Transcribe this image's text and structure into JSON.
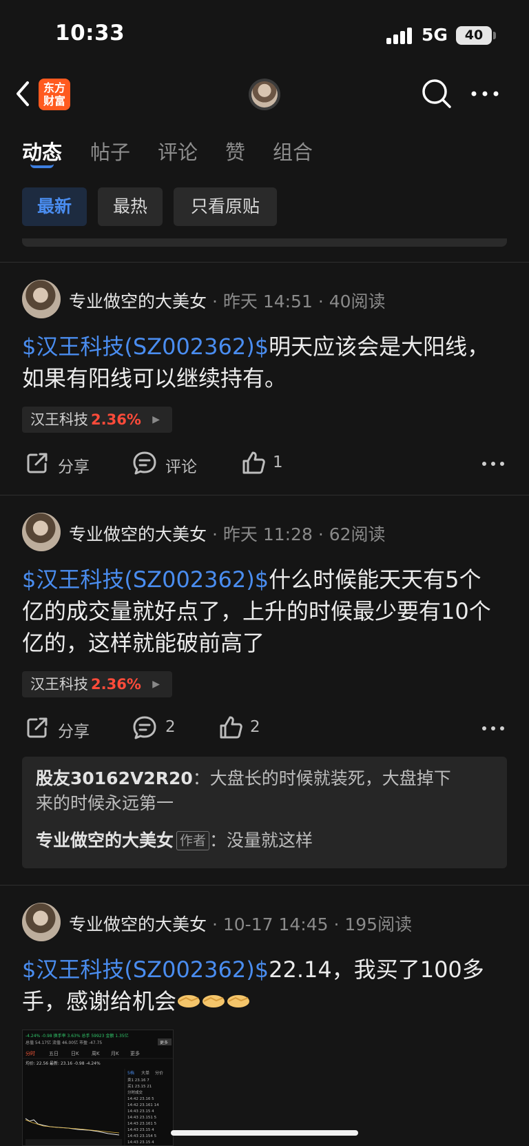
{
  "status": {
    "time": "10:33",
    "network": "5G",
    "battery": "40"
  },
  "nav": {
    "logo_line1": "东方",
    "logo_line2": "财富"
  },
  "tabs": [
    {
      "label": "动态",
      "active": true
    },
    {
      "label": "帖子",
      "active": false
    },
    {
      "label": "评论",
      "active": false
    },
    {
      "label": "赞",
      "active": false
    },
    {
      "label": "组合",
      "active": false
    }
  ],
  "filters": [
    {
      "label": "最新",
      "active": true
    },
    {
      "label": "最热",
      "active": false
    },
    {
      "label": "只看原贴",
      "active": false
    }
  ],
  "posts": [
    {
      "author": "专业做空的大美女",
      "time": "昨天 14:51",
      "reads": "40阅读",
      "tag": "$汉王科技(SZ002362)$",
      "text_line1": "明天应该会是大阳线，",
      "text_line2": "如果有阳线可以继续持有。",
      "stock_name": "汉王科技",
      "stock_pct": "2.36%",
      "share_label": "分享",
      "comment_label": "评论",
      "like_count": "1"
    },
    {
      "author": "专业做空的大美女",
      "time": "昨天 11:28",
      "reads": "62阅读",
      "tag": "$汉王科技(SZ002362)$",
      "text_line1": "什么时候能天天有5个",
      "text_line2": "亿的成交量就好点了，上升的时候最少要有10个",
      "text_line3": "亿的，这样就能破前高了",
      "stock_name": "汉王科技",
      "stock_pct": "2.36%",
      "share_label": "分享",
      "comment_count": "2",
      "like_count": "2",
      "comments": [
        {
          "name": "股友30162V2R20",
          "sep": "：",
          "text_line1": "大盘长的时候就装死，大盘掉下",
          "text_line2": "来的时候永远第一"
        },
        {
          "name": "专业做空的大美女",
          "badge": "作者",
          "sep": "：",
          "text_line1": "没量就这样"
        }
      ]
    },
    {
      "author": "专业做空的大美女",
      "time": "10-17 14:45",
      "reads": "195阅读",
      "tag": "$汉王科技(SZ002362)$",
      "text_line1": "22.14，我买了100多",
      "text_line2": "手，感谢给机会",
      "thumb": {
        "row1": "-4.24%  -0.98  换手率  3.63%  总手  59923  金额  1.35亿",
        "row2": "总值  54.17亿  流值  46.00亿  市盈  -47.75",
        "more": "更多",
        "tabs": [
          "分时",
          "五日",
          "日K",
          "周K",
          "月K",
          "更多"
        ],
        "row3": "均价: 22.56  最新: 23.16  -0.98  -4.24%",
        "side_tabs": [
          "5档",
          "大单",
          "分价"
        ],
        "side_rows": [
          "卖1  23.16  7",
          "买1  23.15  21",
          "分时成交",
          "14:42  23.16  5",
          "14:42  23.161  14",
          "14:43  23.15  4",
          "14:43  23.151  5",
          "14:43  23.161  5",
          "14:43  23.15  4",
          "14:43  23.154  5",
          "14:43  23.15  4"
        ]
      }
    }
  ],
  "colors": {
    "accent": "#4a8df0",
    "up": "#ff4b3a",
    "bg": "#151515"
  }
}
